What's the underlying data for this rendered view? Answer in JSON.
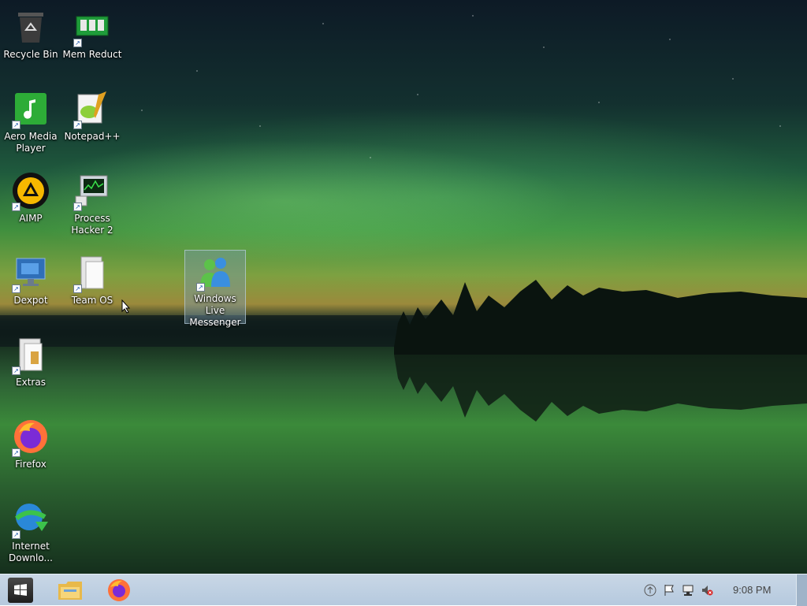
{
  "desktop": {
    "icons": [
      {
        "label": "Recycle Bin",
        "icon": "recycle-bin-icon"
      },
      {
        "label": "Mem Reduct",
        "icon": "memory-chip-icon"
      },
      {
        "label": "Aero Media Player",
        "icon": "music-note-icon"
      },
      {
        "label": "Notepad++",
        "icon": "notepad-plus-icon"
      },
      {
        "label": "AIMP",
        "icon": "aimp-icon"
      },
      {
        "label": "Process Hacker 2",
        "icon": "process-monitor-icon"
      },
      {
        "label": "Dexpot",
        "icon": "virtual-desktop-icon"
      },
      {
        "label": "Team OS",
        "icon": "folder-icon"
      },
      {
        "label": "Windows Live Messenger",
        "icon": "messenger-icon"
      },
      {
        "label": "Extras",
        "icon": "folder-icon"
      },
      {
        "label": "Firefox",
        "icon": "firefox-icon"
      },
      {
        "label": "Internet Downlo...",
        "icon": "download-manager-icon"
      }
    ]
  },
  "taskbar": {
    "start_icon": "windows-logo-icon",
    "pinned": [
      {
        "name": "File Explorer",
        "icon": "file-explorer-icon"
      },
      {
        "name": "Firefox",
        "icon": "firefox-icon"
      }
    ],
    "tray": [
      "up-arrow-icon",
      "flag-icon",
      "network-icon",
      "muted-speaker-icon"
    ],
    "clock": "9:08 PM"
  },
  "colors": {
    "taskbar_top": "#c9d7e6",
    "taskbar_bottom": "#b5c9de",
    "selection": "#7896aa"
  }
}
